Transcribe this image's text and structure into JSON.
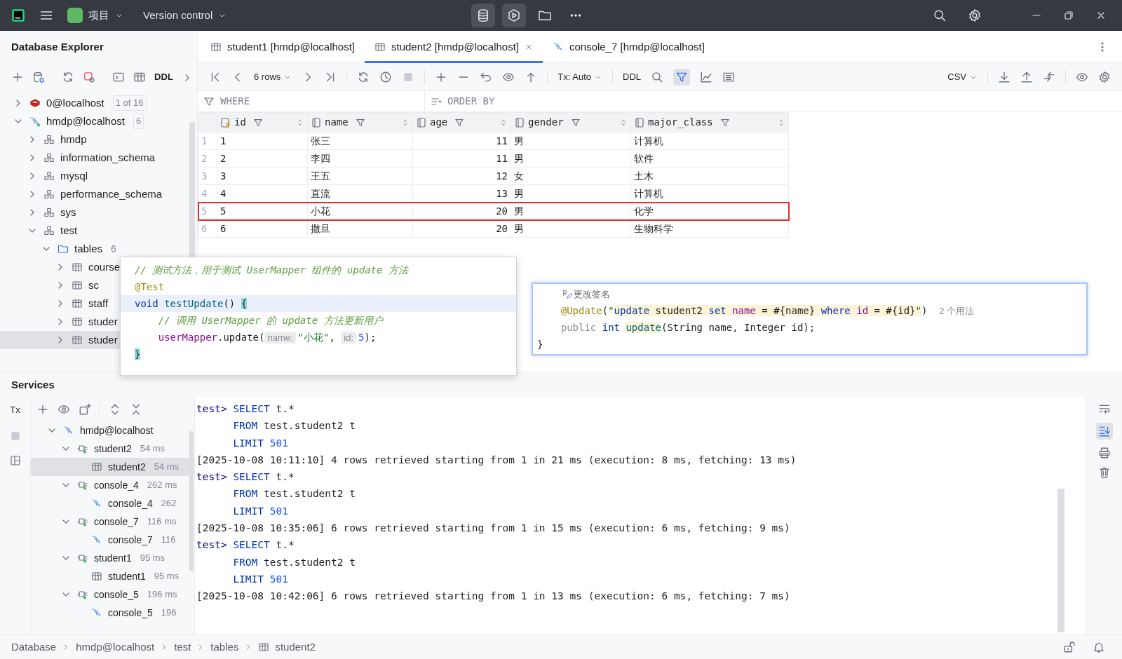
{
  "title_bar": {
    "project": "项目",
    "vcs": "Version control",
    "tool_windows": [
      {
        "selected": true
      },
      {
        "selected": true
      },
      {
        "selected": false
      }
    ]
  },
  "explorer": {
    "title": "Database Explorer",
    "toolbar_label": "DDL",
    "tree": [
      {
        "label": "0@localhost",
        "kind": "redis",
        "badge": "1 of 16",
        "expanded": false
      },
      {
        "label": "hmdp@localhost",
        "kind": "mysql",
        "badge": "6",
        "expanded": true,
        "children": [
          {
            "label": "hmdp",
            "kind": "schema",
            "expanded": false
          },
          {
            "label": "information_schema",
            "kind": "schema",
            "expanded": false
          },
          {
            "label": "mysql",
            "kind": "schema",
            "expanded": false
          },
          {
            "label": "performance_schema",
            "kind": "schema",
            "expanded": false
          },
          {
            "label": "sys",
            "kind": "schema",
            "expanded": false
          },
          {
            "label": "test",
            "kind": "schema",
            "expanded": true,
            "children": [
              {
                "label": "tables",
                "kind": "folder",
                "meta": "6",
                "expanded": true,
                "children": [
                  {
                    "label": "course",
                    "kind": "table",
                    "expanded": false,
                    "selected": false
                  },
                  {
                    "label": "sc",
                    "kind": "table",
                    "expanded": false,
                    "selected": false
                  },
                  {
                    "label": "staff",
                    "kind": "table",
                    "expanded": false,
                    "selected": false
                  },
                  {
                    "label": "studer",
                    "kind": "table",
                    "expanded": false,
                    "selected": false
                  },
                  {
                    "label": "studer",
                    "kind": "table",
                    "expanded": false,
                    "selected": true
                  }
                ]
              }
            ]
          }
        ]
      }
    ]
  },
  "editor_tabs": [
    {
      "label": "student1 [hmdp@localhost]",
      "kind": "table",
      "selected": false
    },
    {
      "label": "student2 [hmdp@localhost]",
      "kind": "table",
      "selected": true,
      "closable": true
    },
    {
      "label": "console_7 [hmdp@localhost]",
      "kind": "console",
      "selected": false
    }
  ],
  "grid_toolbar": {
    "page_size": "6 rows",
    "tx": "Tx: Auto",
    "ddl": "DDL",
    "format": "CSV",
    "filter_on": true
  },
  "filters": {
    "where": "WHERE",
    "order_by": "ORDER BY"
  },
  "table": {
    "columns": [
      {
        "name": "id",
        "kind": "key"
      },
      {
        "name": "name",
        "kind": "column"
      },
      {
        "name": "age",
        "kind": "column",
        "numeric": true
      },
      {
        "name": "gender",
        "kind": "column"
      },
      {
        "name": "major_class",
        "kind": "column"
      }
    ],
    "rows": [
      {
        "number": "1",
        "cells": [
          "1",
          "张三",
          "11",
          "男",
          "计算机"
        ],
        "highlighted": false
      },
      {
        "number": "2",
        "cells": [
          "2",
          "李四",
          "11",
          "男",
          "软件"
        ],
        "highlighted": false
      },
      {
        "number": "3",
        "cells": [
          "3",
          "王五",
          "12",
          "女",
          "土木"
        ],
        "highlighted": false
      },
      {
        "number": "4",
        "cells": [
          "4",
          "直流",
          "13",
          "男",
          "计算机"
        ],
        "highlighted": false
      },
      {
        "number": "5",
        "cells": [
          "5",
          "小花",
          "20",
          "男",
          "化学"
        ],
        "highlighted": true
      },
      {
        "number": "6",
        "cells": [
          "6",
          "撒旦",
          "20",
          "男",
          "生物科学"
        ],
        "highlighted": false
      }
    ]
  },
  "code_popup": {
    "lines": [
      {
        "current": false,
        "tokens": [
          {
            "text": "// 测试方法，用于测试 UserMapper 组件的 update 方法",
            "kind": "comment"
          }
        ]
      },
      {
        "current": false,
        "tokens": [
          {
            "text": "@Test",
            "kind": "annotation"
          }
        ]
      },
      {
        "current": true,
        "tokens": [
          {
            "text": "void",
            "kind": "keyword"
          },
          {
            "text": " testUpdate",
            "kind": "method"
          },
          {
            "text": "() "
          },
          {
            "text": "{",
            "kind": "brace"
          }
        ]
      },
      {
        "current": false,
        "tokens": [
          {
            "text": "    // 调用 UserMapper 的 update 方法更新用户",
            "kind": "comment"
          }
        ]
      },
      {
        "current": false,
        "tokens": [
          {
            "text": "    userMapper",
            "kind": "field"
          },
          {
            "text": ".update("
          },
          {
            "text": "name:",
            "kind": "hint"
          },
          {
            "text": "\"小花\"",
            "kind": "string"
          },
          {
            "text": ", "
          },
          {
            "text": "id:",
            "kind": "hint"
          },
          {
            "text": "5",
            "kind": "number"
          },
          {
            "text": ");"
          }
        ]
      },
      {
        "current": false,
        "tokens": [
          {
            "text": "}",
            "kind": "brace"
          }
        ]
      }
    ]
  },
  "mapper_popup": {
    "hint": "更改签名",
    "lines": [
      {
        "tokens": [
          {
            "text": "    @Update",
            "kind": "annotation"
          },
          {
            "text": "("
          },
          {
            "text": "\"",
            "kind": "string"
          },
          {
            "text": "update",
            "kind": "sql-keyword"
          },
          {
            "text": " student2 ",
            "kind": "sql"
          },
          {
            "text": "set ",
            "kind": "sql-keyword"
          },
          {
            "text": "name",
            "kind": "sql-column"
          },
          {
            "text": " = #{name} ",
            "kind": "sql"
          },
          {
            "text": "where ",
            "kind": "sql-keyword"
          },
          {
            "text": "id",
            "kind": "sql-column"
          },
          {
            "text": " = #{id}",
            "kind": "sql"
          },
          {
            "text": "\"",
            "kind": "sql-quote"
          },
          {
            "text": ")  "
          },
          {
            "text": "2 个用法",
            "kind": "inlay"
          }
        ]
      },
      {
        "tokens": [
          {
            "text": "    public ",
            "kind": "dim"
          },
          {
            "text": "int ",
            "kind": "keyword"
          },
          {
            "text": "update",
            "kind": "method-decl"
          },
          {
            "text": "(String name, Integer id);"
          }
        ]
      },
      {
        "tokens": [
          {
            "text": "}"
          }
        ]
      }
    ]
  },
  "services": {
    "title": "Services",
    "tx": "Tx",
    "tree": [
      {
        "label": "hmdp@localhost",
        "kind": "console",
        "expanded": true,
        "children": [
          {
            "label": "student2",
            "kind": "session",
            "meta": "54 ms",
            "expanded": true,
            "children": [
              {
                "label": "student2",
                "kind": "table",
                "meta": "54 ms",
                "selected": true
              }
            ]
          },
          {
            "label": "console_4",
            "kind": "session",
            "meta": "262 ms",
            "expanded": true,
            "children": [
              {
                "label": "console_4",
                "kind": "console",
                "meta": "262",
                "selected": false
              }
            ]
          },
          {
            "label": "console_7",
            "kind": "session",
            "meta": "116 ms",
            "expanded": true,
            "children": [
              {
                "label": "console_7",
                "kind": "console",
                "meta": "116",
                "selected": false
              }
            ]
          },
          {
            "label": "student1",
            "kind": "session",
            "meta": "95 ms",
            "expanded": true,
            "children": [
              {
                "label": "student1",
                "kind": "table",
                "meta": "95 ms",
                "selected": false
              }
            ]
          },
          {
            "label": "console_5",
            "kind": "session",
            "meta": "196 ms",
            "expanded": true,
            "children": [
              {
                "label": "console_5",
                "kind": "console",
                "meta": "196",
                "selected": false
              }
            ]
          }
        ]
      }
    ],
    "console": {
      "scroll_to_end": true,
      "lines": [
        [
          {
            "text": "test>",
            "kind": "prompt"
          },
          {
            "text": " SELECT",
            "kind": "keyword"
          },
          {
            "text": " t.*"
          }
        ],
        [
          {
            "text": "      FROM",
            "kind": "keyword"
          },
          {
            "text": " test.student2 t"
          }
        ],
        [
          {
            "text": "      LIMIT ",
            "kind": "keyword"
          },
          {
            "text": "501",
            "kind": "number"
          }
        ],
        [
          {
            "text": "[2025-10-08 10:11:10] 4 rows retrieved starting from 1 in 21 ms (execution: 8 ms, fetching: 13 ms)"
          }
        ],
        [
          {
            "text": "test>",
            "kind": "prompt"
          },
          {
            "text": " SELECT",
            "kind": "keyword"
          },
          {
            "text": " t.*"
          }
        ],
        [
          {
            "text": "      FROM",
            "kind": "keyword"
          },
          {
            "text": " test.student2 t"
          }
        ],
        [
          {
            "text": "      LIMIT ",
            "kind": "keyword"
          },
          {
            "text": "501",
            "kind": "number"
          }
        ],
        [
          {
            "text": "[2025-10-08 10:35:06] 6 rows retrieved starting from 1 in 15 ms (execution: 6 ms, fetching: 9 ms)"
          }
        ],
        [
          {
            "text": "test>",
            "kind": "prompt"
          },
          {
            "text": " SELECT",
            "kind": "keyword"
          },
          {
            "text": " t.*"
          }
        ],
        [
          {
            "text": "      FROM",
            "kind": "keyword"
          },
          {
            "text": " test.student2 t"
          }
        ],
        [
          {
            "text": "      LIMIT ",
            "kind": "keyword"
          },
          {
            "text": "501",
            "kind": "number"
          }
        ],
        [
          {
            "text": "[2025-10-08 10:42:06] 6 rows retrieved starting from 1 in 13 ms (execution: 6 ms, fetching: 7 ms)"
          }
        ]
      ]
    }
  },
  "breadcrumb": [
    {
      "text": "Database"
    },
    {
      "text": "hmdp@localhost"
    },
    {
      "text": "test"
    },
    {
      "text": "tables"
    },
    {
      "text": "student2",
      "kind": "table"
    }
  ]
}
